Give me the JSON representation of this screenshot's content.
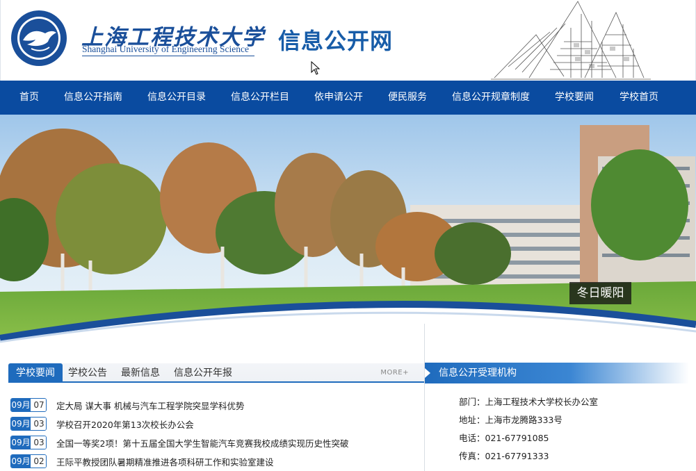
{
  "header": {
    "university_cn": "上海工程技术大学",
    "university_en": "Shanghai University of Engineering Science",
    "site_title": "信息公开网",
    "logo_icon": "university-seal-icon"
  },
  "nav": {
    "items": [
      {
        "label": "首页"
      },
      {
        "label": "信息公开指南"
      },
      {
        "label": "信息公开目录"
      },
      {
        "label": "信息公开栏目"
      },
      {
        "label": "依申请公开"
      },
      {
        "label": "便民服务"
      },
      {
        "label": "信息公开规章制度"
      },
      {
        "label": "学校要闻"
      },
      {
        "label": "学校首页"
      }
    ]
  },
  "banner": {
    "caption": "冬日暖阳"
  },
  "news": {
    "tabs": [
      {
        "label": "学校要闻",
        "active": true
      },
      {
        "label": "学校公告",
        "active": false
      },
      {
        "label": "最新信息",
        "active": false
      },
      {
        "label": "信息公开年报",
        "active": false
      }
    ],
    "more_label": "MORE+",
    "items": [
      {
        "month": "09月",
        "day": "07",
        "title": "定大局 谋大事 机械与汽车工程学院突显学科优势"
      },
      {
        "month": "09月",
        "day": "03",
        "title": "学校召开2020年第13次校长办公会"
      },
      {
        "month": "09月",
        "day": "03",
        "title": "全国一等奖2项！第十五届全国大学生智能汽车竞赛我校成绩实现历史性突破"
      },
      {
        "month": "09月",
        "day": "02",
        "title": "王际平教授团队暑期精准推进各项科研工作和实验室建设"
      }
    ]
  },
  "info": {
    "title": "信息公开受理机构",
    "lines": [
      {
        "text": "部门：上海工程技术大学校长办公室"
      },
      {
        "text": "地址：上海市龙腾路333号"
      },
      {
        "text": "电话：021-67791085"
      },
      {
        "text": "传真：021-67791333"
      }
    ]
  },
  "colors": {
    "brand_blue": "#0a4ba0",
    "accent_blue": "#1f6bbd"
  }
}
